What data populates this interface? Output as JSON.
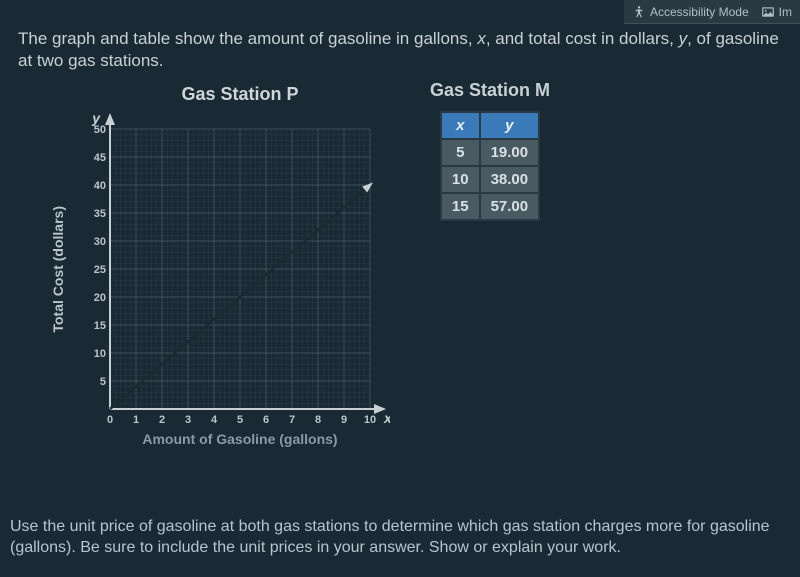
{
  "topbar": {
    "accessibility_label": "Accessibility Mode",
    "image_label": "Im"
  },
  "problem_text": {
    "line1_pre": "The graph and table show the amount of gasoline in gallons, ",
    "var_x": "x",
    "line1_mid": ", and total cost in dollars, ",
    "var_y": "y",
    "line1_post": ", of gasoline at two gas stations."
  },
  "chart_data": {
    "type": "line",
    "title": "Gas Station P",
    "xlabel": "Amount of Gasoline (gallons)",
    "ylabel": "Total Cost (dollars)",
    "x": [
      0,
      1,
      2,
      3,
      4,
      5,
      6,
      7,
      8,
      9,
      10
    ],
    "y": [
      0,
      4,
      8,
      12,
      16,
      20,
      24,
      28,
      32,
      36,
      40
    ],
    "xlim": [
      0,
      10
    ],
    "ylim": [
      0,
      50
    ],
    "x_ticks": [
      0,
      1,
      2,
      3,
      4,
      5,
      6,
      7,
      8,
      9,
      10
    ],
    "y_ticks": [
      5,
      10,
      15,
      20,
      25,
      30,
      35,
      40,
      45,
      50
    ],
    "x_axis_var": "x",
    "y_axis_var": "y"
  },
  "table": {
    "title": "Gas Station M",
    "headers": {
      "x": "x",
      "y": "y"
    },
    "rows": [
      {
        "x": "5",
        "y": "19.00"
      },
      {
        "x": "10",
        "y": "38.00"
      },
      {
        "x": "15",
        "y": "57.00"
      }
    ]
  },
  "prompt_text": "Use the unit price of gasoline at both gas stations to determine which gas station charges more for gasoline (gallons). Be sure to include the unit prices in your answer. Show or explain your work."
}
